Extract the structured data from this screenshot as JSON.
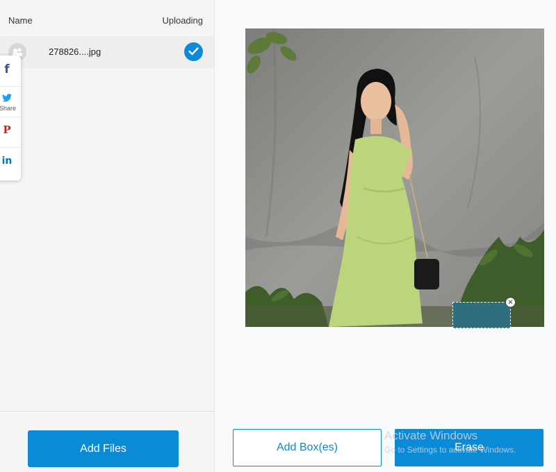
{
  "file_list": {
    "col_name": "Name",
    "col_status": "Uploading",
    "files": [
      {
        "name": "278826....jpg",
        "status_icon": "check-icon"
      }
    ]
  },
  "share_bar": {
    "facebook": "f",
    "twitter_label": "Share",
    "pinterest": "P",
    "linkedin": "in"
  },
  "actions": {
    "add_files": "Add Files",
    "add_boxes": "Add Box(es)",
    "erase": "Erase"
  },
  "selection_close_glyph": "×",
  "watermark": {
    "line1": "Activate Windows",
    "line2": "Go to Settings to activate Windows."
  },
  "colors": {
    "accent": "#0b8ad8",
    "panel_bg": "#f5f5f5",
    "selection_fill": "#2e6e7e"
  }
}
